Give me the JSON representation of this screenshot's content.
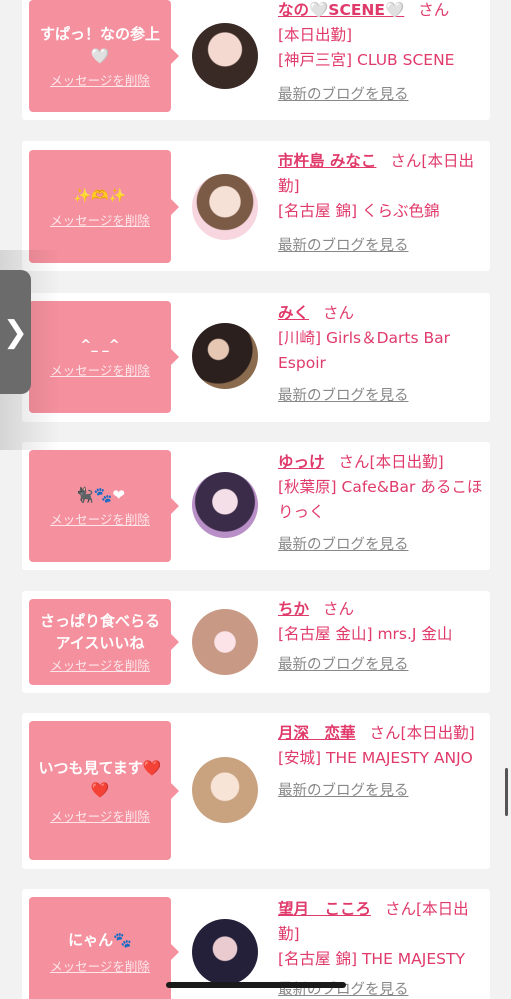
{
  "items": [
    {
      "message": "すぱっ！なの参上🤍",
      "delete_label": "メッセージを削除",
      "name": "なの🤍SCENE🤍",
      "san": "さん",
      "status": "[本日出勤]",
      "shop": "[神戸三宮] CLUB SCENE",
      "blog": "最新のブログを見る",
      "avatar_icon": "profile-photo"
    },
    {
      "message": "✨🫶✨",
      "delete_label": "メッセージを削除",
      "name": "市杵島 みなこ",
      "san": "さん",
      "status": "[本日出勤]",
      "shop": "[名古屋 錦] くらぶ色錦",
      "blog": "最新のブログを見る",
      "avatar_icon": "profile-photo"
    },
    {
      "message": "^_ _^",
      "delete_label": "メッセージを削除",
      "name": "みく",
      "san": "さん",
      "status": "",
      "shop": "[川崎] Girls＆Darts Bar Espoir",
      "blog": "最新のブログを見る",
      "avatar_icon": "profile-photo"
    },
    {
      "message": "🐈‍⬛🐾❤",
      "delete_label": "メッセージを削除",
      "name": "ゆっけ",
      "san": "さん",
      "status": "[本日出勤]",
      "shop": "[秋葉原] Cafe&Bar あるこほりっく",
      "blog": "最新のブログを見る",
      "avatar_icon": "profile-photo"
    },
    {
      "message": "さっぱり食べらるアイスいいね",
      "delete_label": "メッセージを削除",
      "name": "ちか",
      "san": "さん",
      "status": "",
      "shop": "[名古屋 金山] mrs.J 金山",
      "blog": "最新のブログを見る",
      "avatar_icon": "profile-photo"
    },
    {
      "message": "いつも見てます❤️❤️",
      "delete_label": "メッセージを削除",
      "name": "月深　恋華",
      "san": "さん",
      "status": "[本日出勤]",
      "shop": "[安城] THE MAJESTY ANJO",
      "blog": "最新のブログを見る",
      "avatar_icon": "profile-photo"
    },
    {
      "message": "にゃん🐾",
      "delete_label": "メッセージを削除",
      "name": "望月　こころ",
      "san": "さん",
      "status": "[本日出勤]",
      "shop": "[名古屋 錦] THE MAJESTY",
      "blog": "最新のブログを見る",
      "avatar_icon": "profile-photo"
    }
  ],
  "side_tab": {
    "glyph": "❯",
    "icon": "chevron-right-icon"
  },
  "colors": {
    "accent": "#e03a6a",
    "bubble": "#f5909e",
    "background": "#f2f2f2"
  }
}
